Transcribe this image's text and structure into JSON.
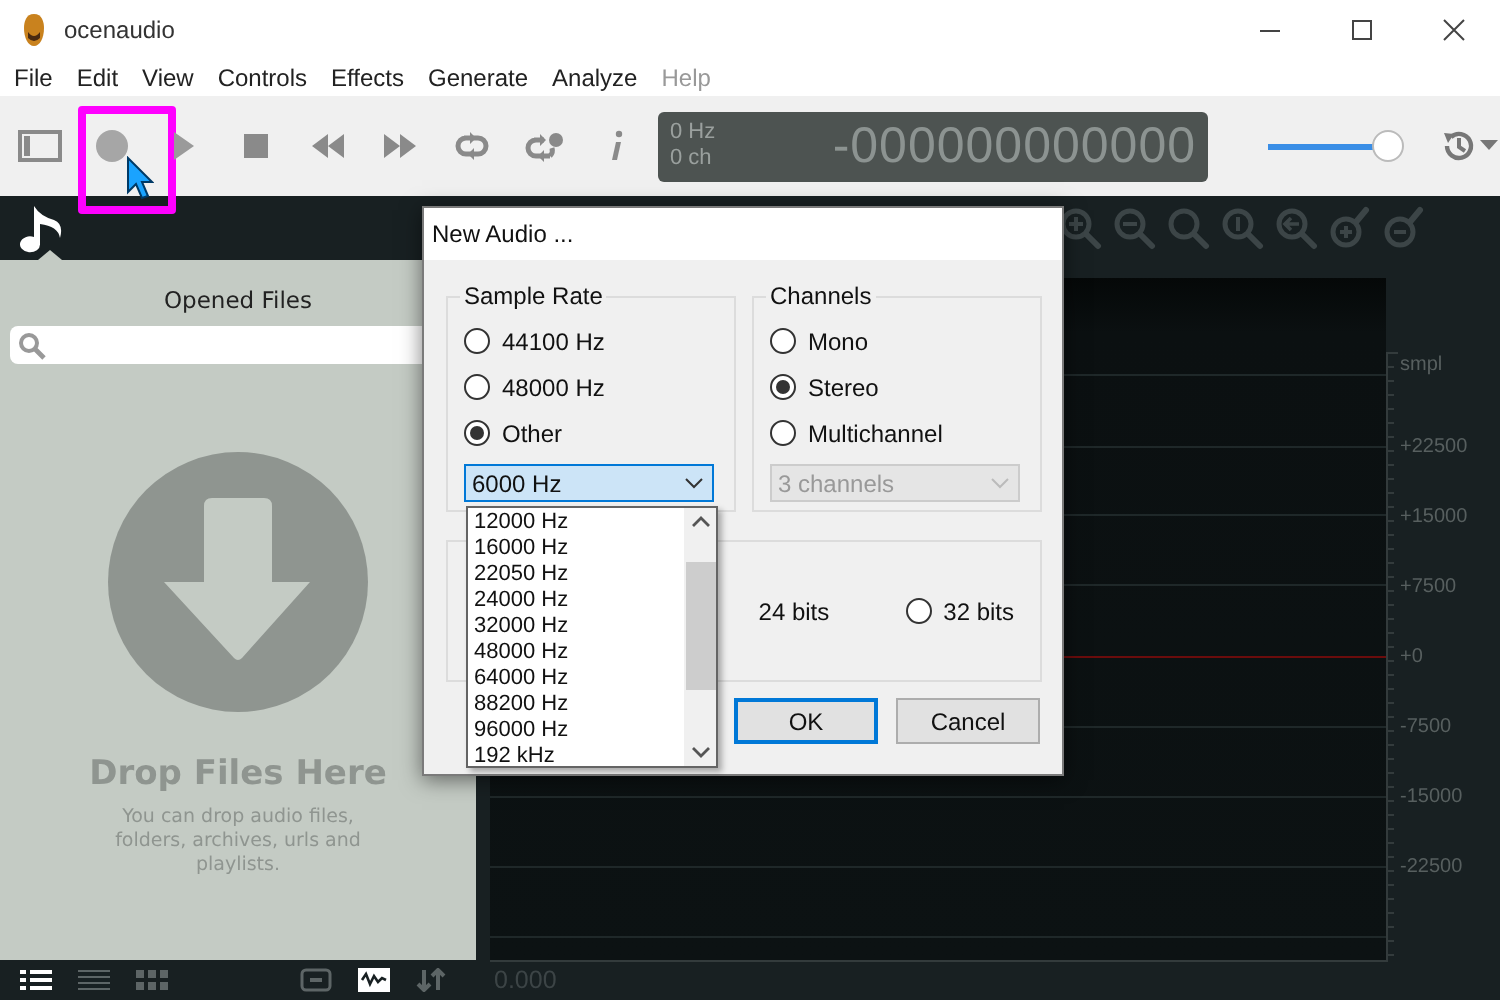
{
  "window": {
    "title": "ocenaudio"
  },
  "menu": [
    {
      "label": "File",
      "disabled": false
    },
    {
      "label": "Edit",
      "disabled": false
    },
    {
      "label": "View",
      "disabled": false
    },
    {
      "label": "Controls",
      "disabled": false
    },
    {
      "label": "Effects",
      "disabled": false
    },
    {
      "label": "Generate",
      "disabled": false
    },
    {
      "label": "Analyze",
      "disabled": false
    },
    {
      "label": "Help",
      "disabled": true
    }
  ],
  "toolbar": {
    "tools": [
      {
        "kind": "sidebar",
        "highlighted": false
      },
      {
        "kind": "record",
        "highlighted": true
      },
      {
        "kind": "play",
        "highlighted": false
      },
      {
        "kind": "stop",
        "highlighted": false
      },
      {
        "kind": "rewind",
        "highlighted": false
      },
      {
        "kind": "forward",
        "highlighted": false
      },
      {
        "kind": "loop",
        "highlighted": false
      },
      {
        "kind": "loop-plus",
        "highlighted": false
      },
      {
        "kind": "info",
        "highlighted": false
      }
    ]
  },
  "display": {
    "frequency": "0 Hz",
    "channels": "0 ch",
    "time": "-000000000000"
  },
  "volume": {
    "level": 0.93
  },
  "sidebar": {
    "title": "Opened Files",
    "drop_title": "Drop Files Here",
    "drop_hint": "You can drop audio files, folders, archives, urls and playlists."
  },
  "view_modes": [
    {
      "kind": "details",
      "selected": true
    },
    {
      "kind": "list",
      "selected": false
    },
    {
      "kind": "grid",
      "selected": false
    }
  ],
  "bottom_tools": [
    {
      "kind": "fit",
      "selected": false
    },
    {
      "kind": "waveform",
      "selected": true
    },
    {
      "kind": "sort",
      "selected": false
    }
  ],
  "waveform": {
    "unit": "smpl",
    "scale": [
      "+22500",
      "+15000",
      "+7500",
      "+0",
      "-7500",
      "-15000",
      "-22500"
    ],
    "time": "0.000"
  },
  "dialog": {
    "title": "New Audio ...",
    "sample_rate": {
      "title": "Sample Rate",
      "options": [
        {
          "label": "44100 Hz",
          "selected": false
        },
        {
          "label": "48000 Hz",
          "selected": false
        },
        {
          "label": "Other",
          "selected": true
        }
      ],
      "select": {
        "value": "6000 Hz",
        "expanded": true,
        "items": [
          "12000 Hz",
          "16000 Hz",
          "22050 Hz",
          "24000 Hz",
          "32000 Hz",
          "48000 Hz",
          "64000 Hz",
          "88200 Hz",
          "96000 Hz",
          "192 kHz"
        ]
      }
    },
    "channels": {
      "title": "Channels",
      "options": [
        {
          "label": "Mono",
          "selected": false
        },
        {
          "label": "Stereo",
          "selected": true
        },
        {
          "label": "Multichannel",
          "selected": false
        }
      ],
      "select": {
        "value": "3 channels",
        "disabled": true
      }
    },
    "bits": {
      "options": [
        {
          "kind": "label",
          "label": "24 bits"
        },
        {
          "kind": "radio",
          "label": "32 bits",
          "selected": false
        }
      ]
    },
    "buttons": [
      {
        "label": "OK",
        "default": true
      },
      {
        "label": "Cancel",
        "default": false
      }
    ]
  }
}
